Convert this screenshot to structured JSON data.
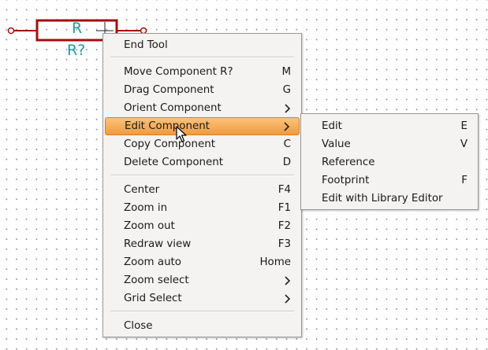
{
  "schematic": {
    "component_value": "R",
    "component_reference": "R?",
    "wire_color": "#a01010",
    "text_color": "#1f9b9b"
  },
  "context_menu": {
    "items": [
      {
        "label": "End Tool",
        "shortcut": ""
      },
      {
        "label": "Move Component R?",
        "shortcut": "M"
      },
      {
        "label": "Drag Component",
        "shortcut": "G"
      },
      {
        "label": "Orient Component",
        "submenu_icon": "chevron-right-icon"
      },
      {
        "label": "Edit Component",
        "submenu_icon": "chevron-right-icon",
        "highlighted": true
      },
      {
        "label": "Copy Component",
        "shortcut": "C"
      },
      {
        "label": "Delete Component",
        "shortcut": "D"
      },
      {
        "label": "Center",
        "shortcut": "F4"
      },
      {
        "label": "Zoom in",
        "shortcut": "F1"
      },
      {
        "label": "Zoom out",
        "shortcut": "F2"
      },
      {
        "label": "Redraw view",
        "shortcut": "F3"
      },
      {
        "label": "Zoom auto",
        "shortcut": "Home"
      },
      {
        "label": "Zoom select",
        "submenu_icon": "chevron-right-icon"
      },
      {
        "label": "Grid Select",
        "submenu_icon": "chevron-right-icon"
      },
      {
        "label": "Close",
        "shortcut": ""
      }
    ]
  },
  "edit_submenu": {
    "items": [
      {
        "label": "Edit",
        "shortcut": "E"
      },
      {
        "label": "Value",
        "shortcut": "V"
      },
      {
        "label": "Reference",
        "shortcut": ""
      },
      {
        "label": "Footprint",
        "shortcut": "F"
      },
      {
        "label": "Edit with Library Editor",
        "shortcut": ""
      }
    ]
  },
  "highlight_color": "#f5a64b",
  "cursor_icon": "arrow-cursor-icon"
}
